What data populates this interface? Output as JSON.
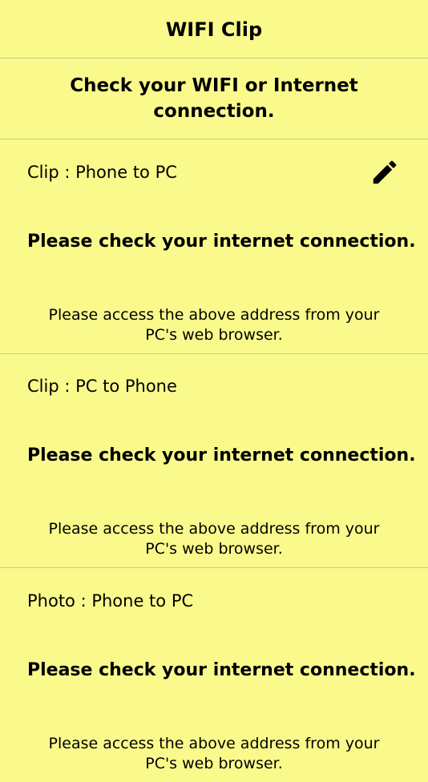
{
  "app": {
    "title": "WIFI Clip"
  },
  "banner": {
    "message": "Check your WIFI or Internet connection."
  },
  "sections": [
    {
      "title": "Clip : Phone to PC",
      "status": "Please check your internet connection.",
      "hint": "Please access the above address from your PC's web browser.",
      "action_icon": "pencil-icon"
    },
    {
      "title": "Clip : PC to Phone",
      "status": "Please check your internet connection.",
      "hint": "Please access the above address from your PC's web browser."
    },
    {
      "title": "Photo : Phone to PC",
      "status": "Please check your internet connection.",
      "hint": "Please access the above address from your PC's web browser."
    }
  ],
  "colors": {
    "background": "#fafa8c",
    "divider": "#c9c98a",
    "text": "#000000"
  }
}
